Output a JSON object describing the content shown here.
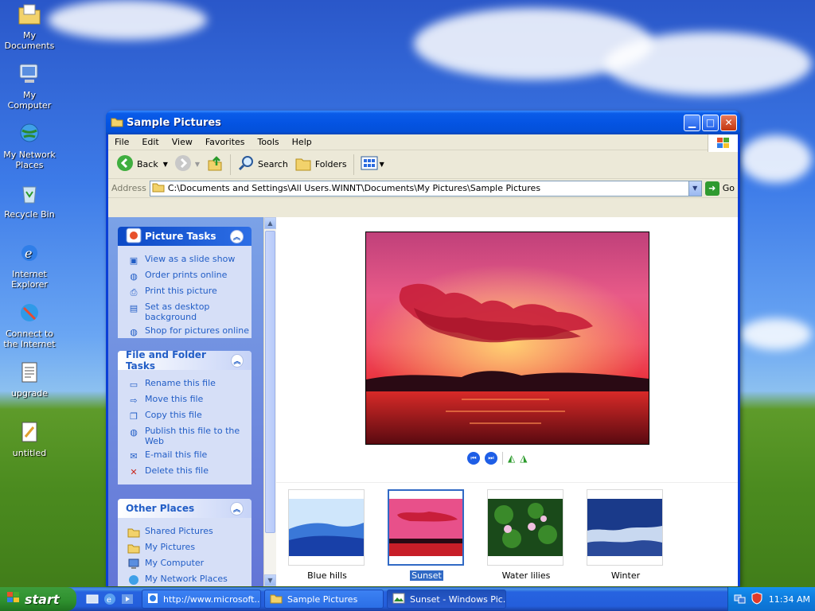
{
  "desktop": {
    "icons": [
      {
        "label": "My Documents",
        "icon": "folder-documents-icon"
      },
      {
        "label": "My Computer",
        "icon": "computer-icon"
      },
      {
        "label": "My Network Places",
        "icon": "network-icon"
      },
      {
        "label": "Recycle Bin",
        "icon": "recycle-bin-icon"
      },
      {
        "label": "Internet Explorer",
        "icon": "internet-explorer-icon"
      },
      {
        "label": "Connect to the Internet",
        "icon": "connect-internet-icon"
      },
      {
        "label": "upgrade",
        "icon": "text-file-icon"
      },
      {
        "label": "untitled",
        "icon": "image-file-icon"
      }
    ]
  },
  "window": {
    "title": "Sample Pictures",
    "menu": [
      "File",
      "Edit",
      "View",
      "Favorites",
      "Tools",
      "Help"
    ],
    "toolbar": {
      "back": "Back",
      "search": "Search",
      "folders": "Folders"
    },
    "address": {
      "label": "Address",
      "path": "C:\\Documents and Settings\\All Users.WINNT\\Documents\\My Pictures\\Sample Pictures",
      "go": "Go"
    }
  },
  "taskpane": {
    "picture_tasks": {
      "title": "Picture Tasks",
      "items": [
        "View as a slide show",
        "Order prints online",
        "Print this picture",
        "Set as desktop background",
        "Shop for pictures online"
      ]
    },
    "file_tasks": {
      "title": "File and Folder Tasks",
      "items": [
        "Rename this file",
        "Move this file",
        "Copy this file",
        "Publish this file to the Web",
        "E-mail this file",
        "Delete this file"
      ]
    },
    "other_places": {
      "title": "Other Places",
      "items": [
        "Shared Pictures",
        "My Pictures",
        "My Computer",
        "My Network Places"
      ]
    }
  },
  "filmstrip": {
    "items": [
      {
        "label": "Blue hills",
        "selected": false
      },
      {
        "label": "Sunset",
        "selected": true
      },
      {
        "label": "Water lilies",
        "selected": false
      },
      {
        "label": "Winter",
        "selected": false
      }
    ]
  },
  "taskbar": {
    "start": "start",
    "tasks": [
      {
        "label": "http://www.microsoft....",
        "icon": "ie-window-icon"
      },
      {
        "label": "Sample Pictures",
        "icon": "folder-icon"
      },
      {
        "label": "Sunset - Windows Pic...",
        "icon": "picture-viewer-icon"
      }
    ],
    "clock": "11:34 AM"
  }
}
